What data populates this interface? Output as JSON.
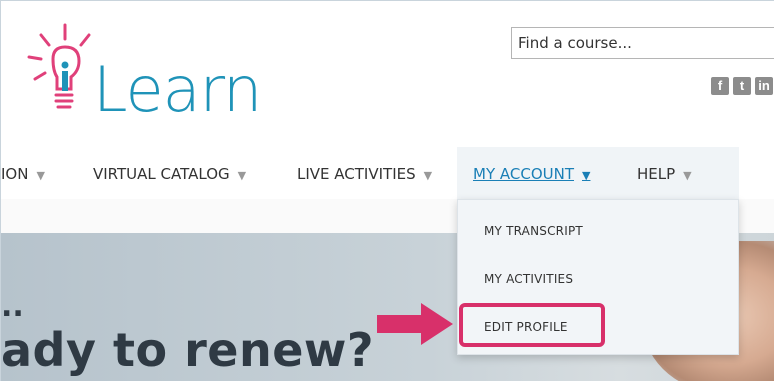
{
  "logo": {
    "text": "Learn"
  },
  "search": {
    "placeholder": "Find a course..."
  },
  "social": {
    "facebook": "f",
    "twitter": "t",
    "linkedin": "in"
  },
  "nav": {
    "items": [
      {
        "label": "ION"
      },
      {
        "label": "VIRTUAL CATALOG"
      },
      {
        "label": "LIVE ACTIVITIES"
      },
      {
        "label": "MY ACCOUNT"
      },
      {
        "label": "HELP"
      }
    ],
    "caret": "▼"
  },
  "dropdown": {
    "items": [
      {
        "label": "MY TRANSCRIPT"
      },
      {
        "label": "MY ACTIVITIES"
      },
      {
        "label": "EDIT PROFILE"
      }
    ]
  },
  "hero": {
    "dots": "..",
    "title": "ady to renew?"
  },
  "colors": {
    "brand": "#1f93b8",
    "bulb": "#e0407a",
    "active_link": "#1a7fb6",
    "callout": "#d8306a"
  }
}
